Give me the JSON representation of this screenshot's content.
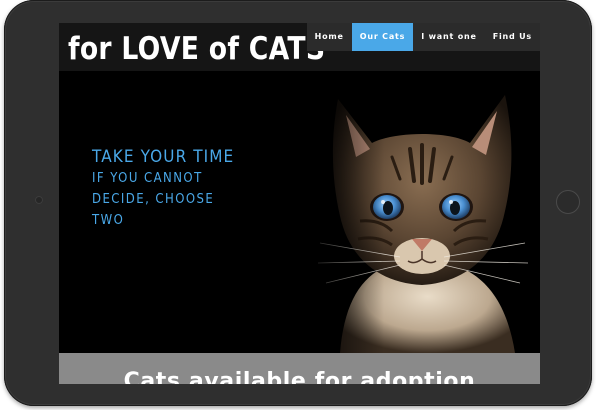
{
  "site": {
    "title": "for LOVE of CATS"
  },
  "nav": {
    "items": [
      {
        "label": "Home",
        "active": false
      },
      {
        "label": "Our Cats",
        "active": true
      },
      {
        "label": "I want one",
        "active": false
      },
      {
        "label": "Find Us",
        "active": false
      }
    ]
  },
  "hero": {
    "heading": "TAKE YOUR TIME",
    "subheading": "IF YOU CANNOT DECIDE, CHOOSE TWO",
    "image": "cat-portrait"
  },
  "adoption": {
    "title": "Cats available for adoption"
  },
  "colors": {
    "accent": "#4aa8e8",
    "header_bg": "#151515",
    "band_bg": "#8a8a8a",
    "tablet_frame": "#2f2f2f"
  }
}
